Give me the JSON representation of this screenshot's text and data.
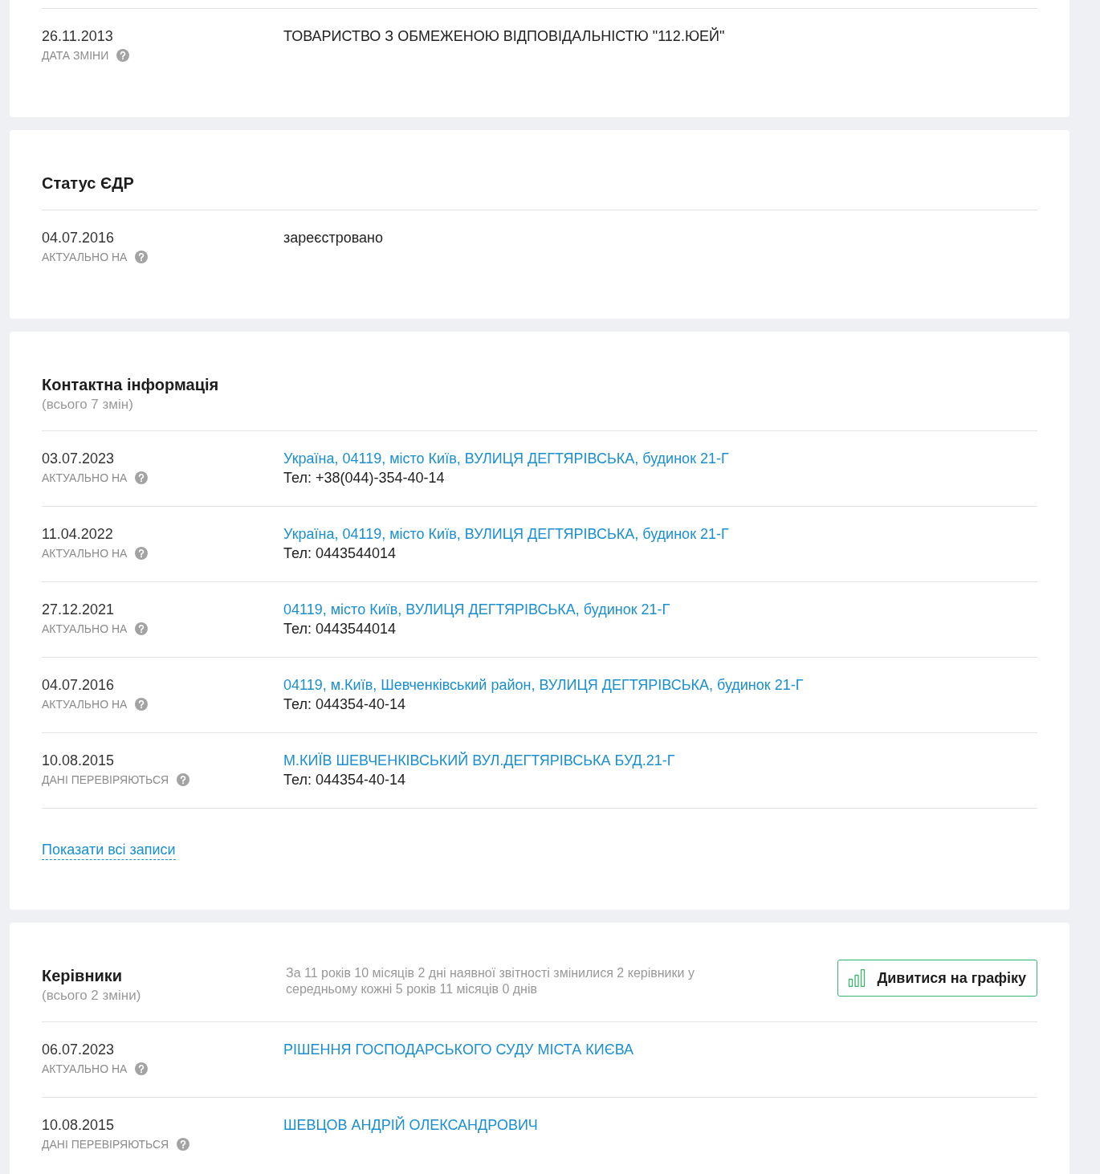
{
  "sections": [
    {
      "records": [
        {
          "date": "26.11.2013",
          "date_label": "ДАТА ЗМІНИ",
          "lines": [
            {
              "kind": "text",
              "text": "ТОВАРИСТВО З ОБМЕЖЕНОЮ ВІДПОВІДАЛЬНІСТЮ \"112.ЮЕЙ\""
            }
          ]
        }
      ]
    },
    {
      "title": "Статус ЄДР",
      "records": [
        {
          "date": "04.07.2016",
          "date_label": "АКТУАЛЬНО НА",
          "lines": [
            {
              "kind": "text",
              "text": "зареєстровано"
            }
          ]
        }
      ]
    },
    {
      "title": "Контактна інформація",
      "subtitle": "(всього 7 змін)",
      "records": [
        {
          "date": "03.07.2023",
          "date_label": "АКТУАЛЬНО НА",
          "lines": [
            {
              "kind": "link",
              "text": "Україна, 04119, місто Київ, ВУЛИЦЯ ДЕГТЯРІВСЬКА, будинок 21-Г"
            },
            {
              "kind": "text",
              "text": "Тел: +38(044)-354-40-14"
            }
          ]
        },
        {
          "date": "11.04.2022",
          "date_label": "АКТУАЛЬНО НА",
          "lines": [
            {
              "kind": "link",
              "text": "Україна, 04119, місто Київ, ВУЛИЦЯ ДЕГТЯРІВСЬКА, будинок 21-Г"
            },
            {
              "kind": "text",
              "text": "Тел: 0443544014"
            }
          ]
        },
        {
          "date": "27.12.2021",
          "date_label": "АКТУАЛЬНО НА",
          "lines": [
            {
              "kind": "link",
              "text": "04119, місто Київ, ВУЛИЦЯ ДЕГТЯРІВСЬКА, будинок 21-Г"
            },
            {
              "kind": "text",
              "text": "Тел: 0443544014"
            }
          ]
        },
        {
          "date": "04.07.2016",
          "date_label": "АКТУАЛЬНО НА",
          "lines": [
            {
              "kind": "link",
              "text": "04119, м.Київ, Шевченківський район, ВУЛИЦЯ ДЕГТЯРІВСЬКА, будинок 21-Г"
            },
            {
              "kind": "text",
              "text": "Тел: 044354-40-14"
            }
          ]
        },
        {
          "date": "10.08.2015",
          "date_label": "ДАНІ ПЕРЕВІРЯЮТЬСЯ",
          "lines": [
            {
              "kind": "link",
              "text": "М.КИЇВ ШЕВЧЕНКІВСЬКИЙ ВУЛ.ДЕГТЯРІВСЬКА БУД.21-Г"
            },
            {
              "kind": "text",
              "text": "Тел: 044354-40-14"
            }
          ]
        }
      ],
      "show_all_link": "Показати всі записи"
    },
    {
      "title": "Керівники",
      "subtitle": "(всього 2 зміни)",
      "summary": "За 11 років 10 місяців 2 дні наявної звітності змінилися 2 керівники у середньому кожні 5 років 11 місяців 0 днів",
      "chart_button": "Дивитися на графіку",
      "records": [
        {
          "date": "06.07.2023",
          "date_label": "АКТУАЛЬНО НА",
          "lines": [
            {
              "kind": "link",
              "text": "РІШЕННЯ ГОСПОДАРСЬКОГО СУДУ МІСТА КИЄВА"
            }
          ]
        },
        {
          "date": "10.08.2015",
          "date_label": "ДАНІ ПЕРЕВІРЯЮТЬСЯ",
          "lines": [
            {
              "kind": "link",
              "text": "ШЕВЦОВ АНДРІЙ ОЛЕКСАНДРОВИЧ"
            }
          ]
        }
      ]
    }
  ]
}
